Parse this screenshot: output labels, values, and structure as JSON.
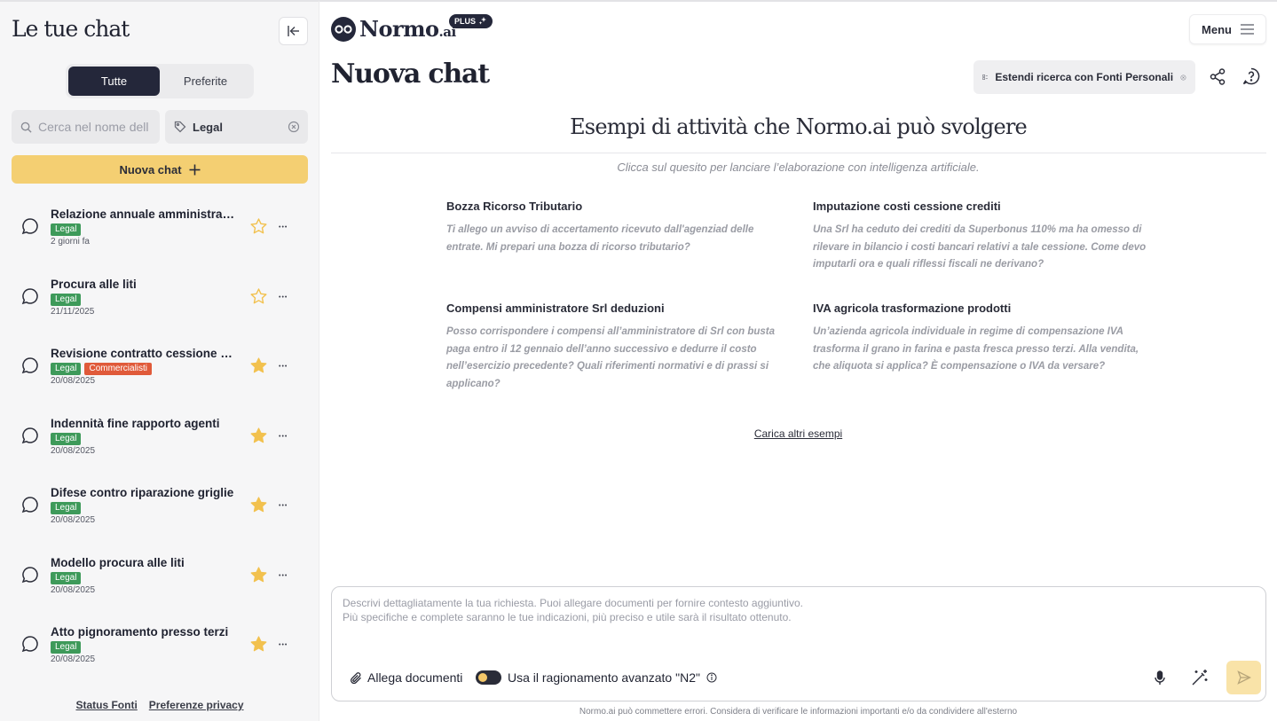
{
  "sidebar": {
    "title": "Le tue chat",
    "segments": [
      "Tutte",
      "Preferite"
    ],
    "search_placeholder": "Cerca nel nome della chat",
    "tag_filter": "Legal",
    "new_chat_label": "Nuova chat",
    "chats": [
      {
        "title": "Relazione annuale amministrazione",
        "tags": [
          "Legal"
        ],
        "date": "2 giorni fa",
        "starred": false
      },
      {
        "title": "Procura alle liti",
        "tags": [
          "Legal"
        ],
        "date": "21/11/2025",
        "starred": false
      },
      {
        "title": "Revisione contratto cessione azienda",
        "tags": [
          "Legal",
          "Commercialisti"
        ],
        "date": "20/08/2025",
        "starred": true
      },
      {
        "title": "Indennità fine rapporto agenti",
        "tags": [
          "Legal"
        ],
        "date": "20/08/2025",
        "starred": true
      },
      {
        "title": "Difese contro riparazione griglie",
        "tags": [
          "Legal"
        ],
        "date": "20/08/2025",
        "starred": true
      },
      {
        "title": "Modello procura alle liti",
        "tags": [
          "Legal"
        ],
        "date": "20/08/2025",
        "starred": true
      },
      {
        "title": "Atto pignoramento presso terzi",
        "tags": [
          "Legal"
        ],
        "date": "20/08/2025",
        "starred": true
      }
    ],
    "footer": {
      "status": "Status Fonti",
      "privacy": "Preferenze privacy"
    }
  },
  "header": {
    "logo": "Normo",
    "logo_suffix": ".ai",
    "plan_badge": "PLUS",
    "menu_label": "Menu"
  },
  "main": {
    "title": "Nuova chat",
    "extend_label": "Estendi ricerca con Fonti Personali",
    "examples_title": "Esempi di attività che Normo.ai può svolgere",
    "examples_subtitle": "Clicca sul quesito per lanciare l’elaborazione con intelligenza artificiale.",
    "examples": [
      {
        "title": "Bozza Ricorso Tributario",
        "text": "Ti allego un avviso di accertamento ricevuto dall'agenziad delle entrate. Mi prepari una bozza di ricorso tributario?"
      },
      {
        "title": "Imputazione costi cessione crediti",
        "text": "Una Srl ha ceduto dei crediti da Superbonus 110% ma ha omesso di rilevare in bilancio i costi bancari relativi a tale cessione. Come devo imputarli ora e quali riflessi fiscali ne derivano?"
      },
      {
        "title": "Compensi amministratore Srl deduzioni",
        "text": "Posso corrispondere i compensi all’amministratore di Srl con busta paga entro il 12 gennaio dell’anno successivo e dedurre il costo nell’esercizio precedente? Quali riferimenti normativi e di prassi si applicano?"
      },
      {
        "title": "IVA agricola trasformazione prodotti",
        "text": "Un’azienda agricola individuale in regime di compensazione IVA trasforma il grano in farina e pasta fresca presso terzi. Alla vendita, che aliquota si applica? È compensazione o IVA da versare?"
      }
    ],
    "load_more": "Carica altri esempi"
  },
  "composer": {
    "placeholder": "Descrivi dettagliatamente la tua richiesta. Puoi allegare documenti per fornire contesto aggiuntivo.\nPiù specifiche e complete saranno le tue indicazioni, più preciso e utile sarà il risultato ottenuto.",
    "attach_label": "Allega documenti",
    "reasoning_label": "Usa il ragionamento avanzato \"N2\""
  },
  "disclaimer": "Normo.ai può commettere errori. Considera di verificare le informazioni importanti e/o da condividere all'esterno",
  "colors": {
    "accent": "#f4cf72",
    "dark": "#24273a",
    "legal_tag": "#3e9a5a",
    "comm_tag": "#e05a3a",
    "star": "#f2c14e"
  },
  "icons": [
    "collapse-sidebar-icon",
    "search-icon",
    "tag-icon",
    "clear-icon",
    "plus-icon",
    "chat-bubble-icon",
    "star-icon",
    "more-icon",
    "sparkle-icon",
    "menu-icon",
    "sources-icon",
    "share-icon",
    "help-icon",
    "paperclip-icon",
    "info-icon",
    "microphone-icon",
    "magic-wand-icon",
    "send-icon"
  ]
}
